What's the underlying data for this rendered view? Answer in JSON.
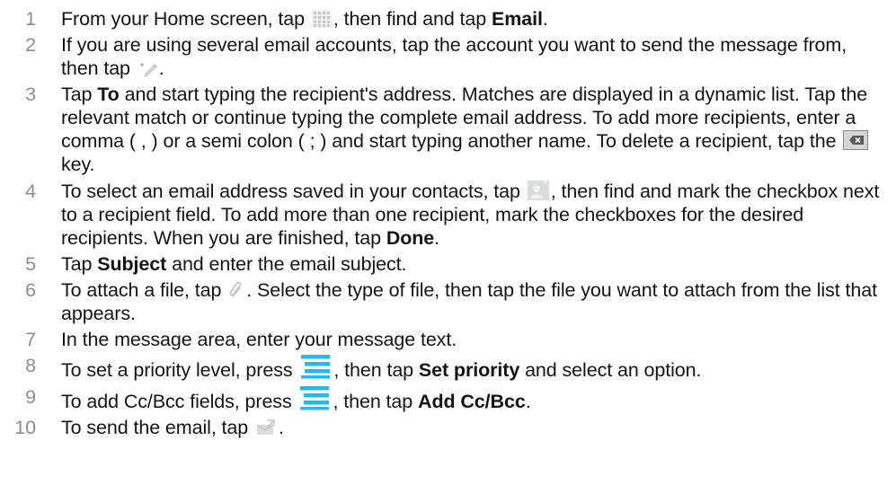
{
  "steps": [
    {
      "number": "1",
      "parts": [
        {
          "t": "From your Home screen, tap "
        },
        {
          "icon": "apps-grid-icon"
        },
        {
          "t": ", then find and tap "
        },
        {
          "b": "Email"
        },
        {
          "t": "."
        }
      ]
    },
    {
      "number": "2",
      "parts": [
        {
          "t": "If you are using several email accounts, tap the account you want to send the message from, then tap "
        },
        {
          "icon": "compose-icon"
        },
        {
          "t": "."
        }
      ]
    },
    {
      "number": "3",
      "parts": [
        {
          "t": "Tap "
        },
        {
          "b": "To"
        },
        {
          "t": " and start typing the recipient's address. Matches are displayed in a dynamic list. Tap the relevant match or continue typing the complete email address. To add more recipients, enter a comma ( , ) or a semi colon ( ; ) and start typing another name. To delete a recipient, tap the "
        },
        {
          "icon": "backspace-key-icon"
        },
        {
          "t": " key."
        }
      ]
    },
    {
      "number": "4",
      "parts": [
        {
          "t": "To select an email address saved in your contacts, tap "
        },
        {
          "icon": "contacts-icon"
        },
        {
          "t": ", then find and mark the checkbox next to a recipient field. To add more than one recipient, mark the checkboxes for the desired recipients. When you are finished, tap "
        },
        {
          "b": "Done"
        },
        {
          "t": "."
        }
      ]
    },
    {
      "number": "5",
      "parts": [
        {
          "t": "Tap "
        },
        {
          "b": "Subject"
        },
        {
          "t": " and enter the email subject."
        }
      ]
    },
    {
      "number": "6",
      "parts": [
        {
          "t": "To attach a file, tap "
        },
        {
          "icon": "paperclip-icon"
        },
        {
          "t": ". Select the type of file, then tap the file you want to attach from the list that appears."
        }
      ]
    },
    {
      "number": "7",
      "parts": [
        {
          "t": "In the message area, enter your message text."
        }
      ]
    },
    {
      "number": "8",
      "parts": [
        {
          "t": "To set a priority level, press "
        },
        {
          "icon": "menu-key-icon"
        },
        {
          "t": ", then tap "
        },
        {
          "b": "Set priority"
        },
        {
          "t": " and select an option."
        }
      ]
    },
    {
      "number": "9",
      "parts": [
        {
          "t": "To add Cc/Bcc fields, press "
        },
        {
          "icon": "menu-key-icon"
        },
        {
          "t": ", then tap "
        },
        {
          "b": "Add Cc/Bcc"
        },
        {
          "t": "."
        }
      ]
    },
    {
      "number": "10",
      "parts": [
        {
          "t": "To send the email, tap "
        },
        {
          "icon": "send-icon"
        },
        {
          "t": "."
        }
      ]
    }
  ],
  "colors": {
    "step_number": "#8c8c8c",
    "body_text": "#141414",
    "menu_key_accent": "#29b6e8"
  }
}
